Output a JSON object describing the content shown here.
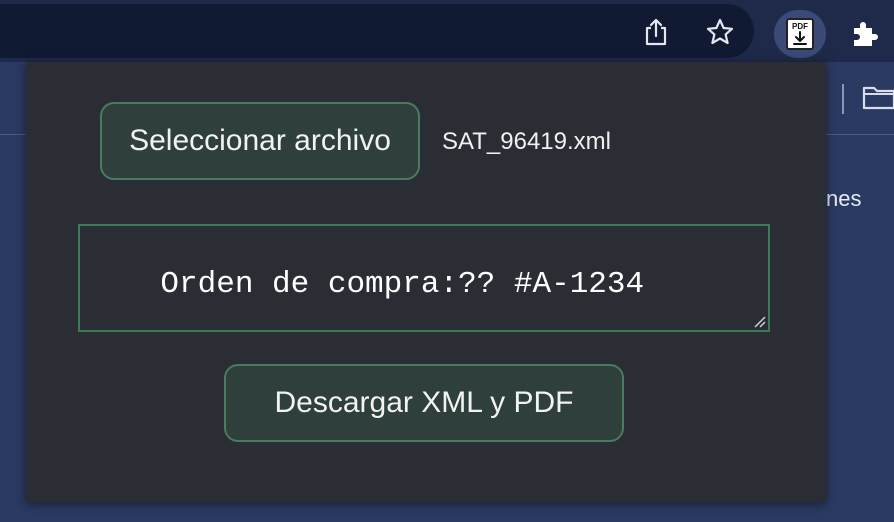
{
  "toolbar": {
    "icons": [
      "share-icon",
      "star-icon",
      "pdf-download-extension-icon",
      "puzzle-extensions-icon"
    ],
    "pdf_icon_text": "PDF"
  },
  "background": {
    "partial_text": "nes",
    "folder_icon": "folder-icon"
  },
  "popup": {
    "select_button_label": "Seleccionar archivo",
    "selected_file": "SAT_96419.xml",
    "textarea_value": "Orden de compra:?? #A-1234",
    "download_button_label": "Descargar XML y PDF"
  },
  "colors": {
    "button_bg": "#2e3f3c",
    "button_border": "#4a7a62",
    "textarea_border": "#3d7a55",
    "popup_bg": "#2a2d33",
    "page_bg": "#2b3a63"
  }
}
